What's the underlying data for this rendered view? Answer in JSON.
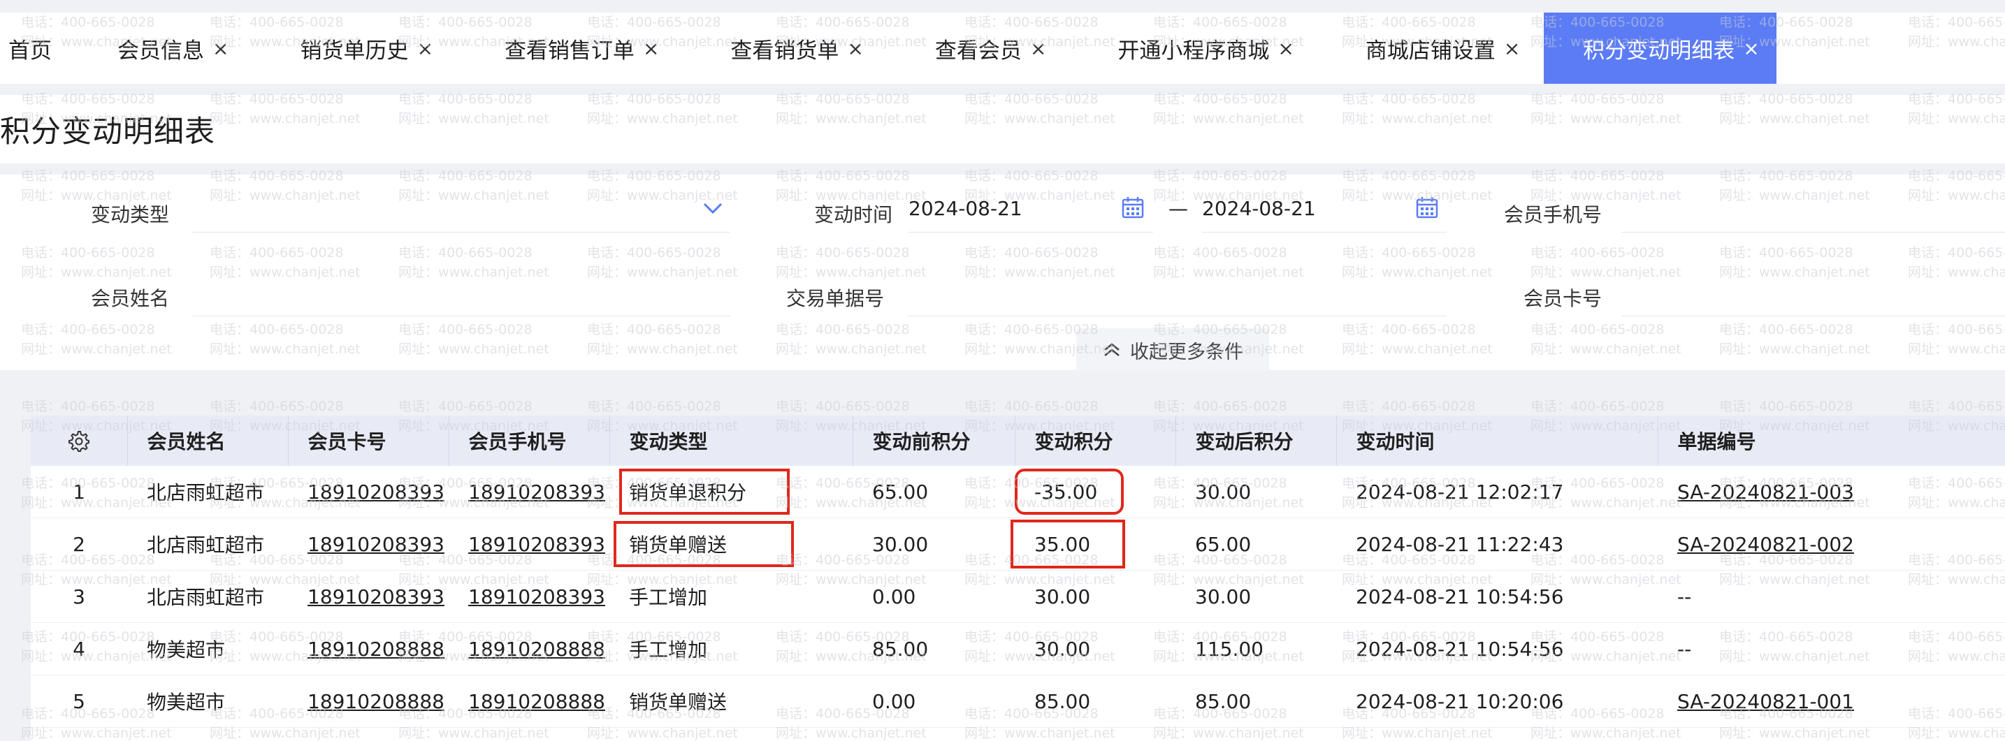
{
  "tabs": [
    {
      "label": "首页",
      "closable": false,
      "active": false
    },
    {
      "label": "会员信息",
      "closable": true,
      "active": false
    },
    {
      "label": "销货单历史",
      "closable": true,
      "active": false
    },
    {
      "label": "查看销售订单",
      "closable": true,
      "active": false
    },
    {
      "label": "查看销货单",
      "closable": true,
      "active": false
    },
    {
      "label": "查看会员",
      "closable": true,
      "active": false
    },
    {
      "label": "开通小程序商城",
      "closable": true,
      "active": false
    },
    {
      "label": "商城店铺设置",
      "closable": true,
      "active": false
    },
    {
      "label": "积分变动明细表",
      "closable": true,
      "active": true
    }
  ],
  "close_glyph": "×",
  "page_title": "积分变动明细表",
  "filters": {
    "change_type_label": "变动类型",
    "change_time_label": "变动时间",
    "date_from": "2024-08-21",
    "date_sep": "—",
    "date_to": "2024-08-21",
    "member_phone_label": "会员手机号",
    "member_name_label": "会员姓名",
    "trade_no_label": "交易单据号",
    "member_card_label": "会员卡号",
    "collapse_label": "收起更多条件"
  },
  "table": {
    "columns": [
      "会员姓名",
      "会员卡号",
      "会员手机号",
      "变动类型",
      "变动前积分",
      "变动积分",
      "变动后积分",
      "变动时间",
      "单据编号"
    ],
    "rows": [
      {
        "idx": "1",
        "name": "北店雨虹超市",
        "card": "18910208393",
        "phone": "18910208393",
        "type": "销货单退积分",
        "before": "65.00",
        "change": "-35.00",
        "after": "30.00",
        "time": "2024-08-21 12:02:17",
        "doc": "SA-20240821-003"
      },
      {
        "idx": "2",
        "name": "北店雨虹超市",
        "card": "18910208393",
        "phone": "18910208393",
        "type": "销货单赠送",
        "before": "30.00",
        "change": "35.00",
        "after": "65.00",
        "time": "2024-08-21 11:22:43",
        "doc": "SA-20240821-002"
      },
      {
        "idx": "3",
        "name": "北店雨虹超市",
        "card": "18910208393",
        "phone": "18910208393",
        "type": "手工增加",
        "before": "0.00",
        "change": "30.00",
        "after": "30.00",
        "time": "2024-08-21 10:54:56",
        "doc": "--"
      },
      {
        "idx": "4",
        "name": "物美超市",
        "card": "18910208888",
        "phone": "18910208888",
        "type": "手工增加",
        "before": "85.00",
        "change": "30.00",
        "after": "115.00",
        "time": "2024-08-21 10:54:56",
        "doc": "--"
      },
      {
        "idx": "5",
        "name": "物美超市",
        "card": "18910208888",
        "phone": "18910208888",
        "type": "销货单赠送",
        "before": "0.00",
        "change": "85.00",
        "after": "85.00",
        "time": "2024-08-21 10:20:06",
        "doc": "SA-20240821-001"
      }
    ]
  },
  "icons": {
    "settings": "gear-icon",
    "dropdown": "chevron-down-icon",
    "calendar": "calendar-icon",
    "collapse": "chevron-up-icon"
  },
  "colors": {
    "accent": "#5b7cf5",
    "highlight": "#e0271c",
    "header_bg": "#e8ebf6"
  }
}
